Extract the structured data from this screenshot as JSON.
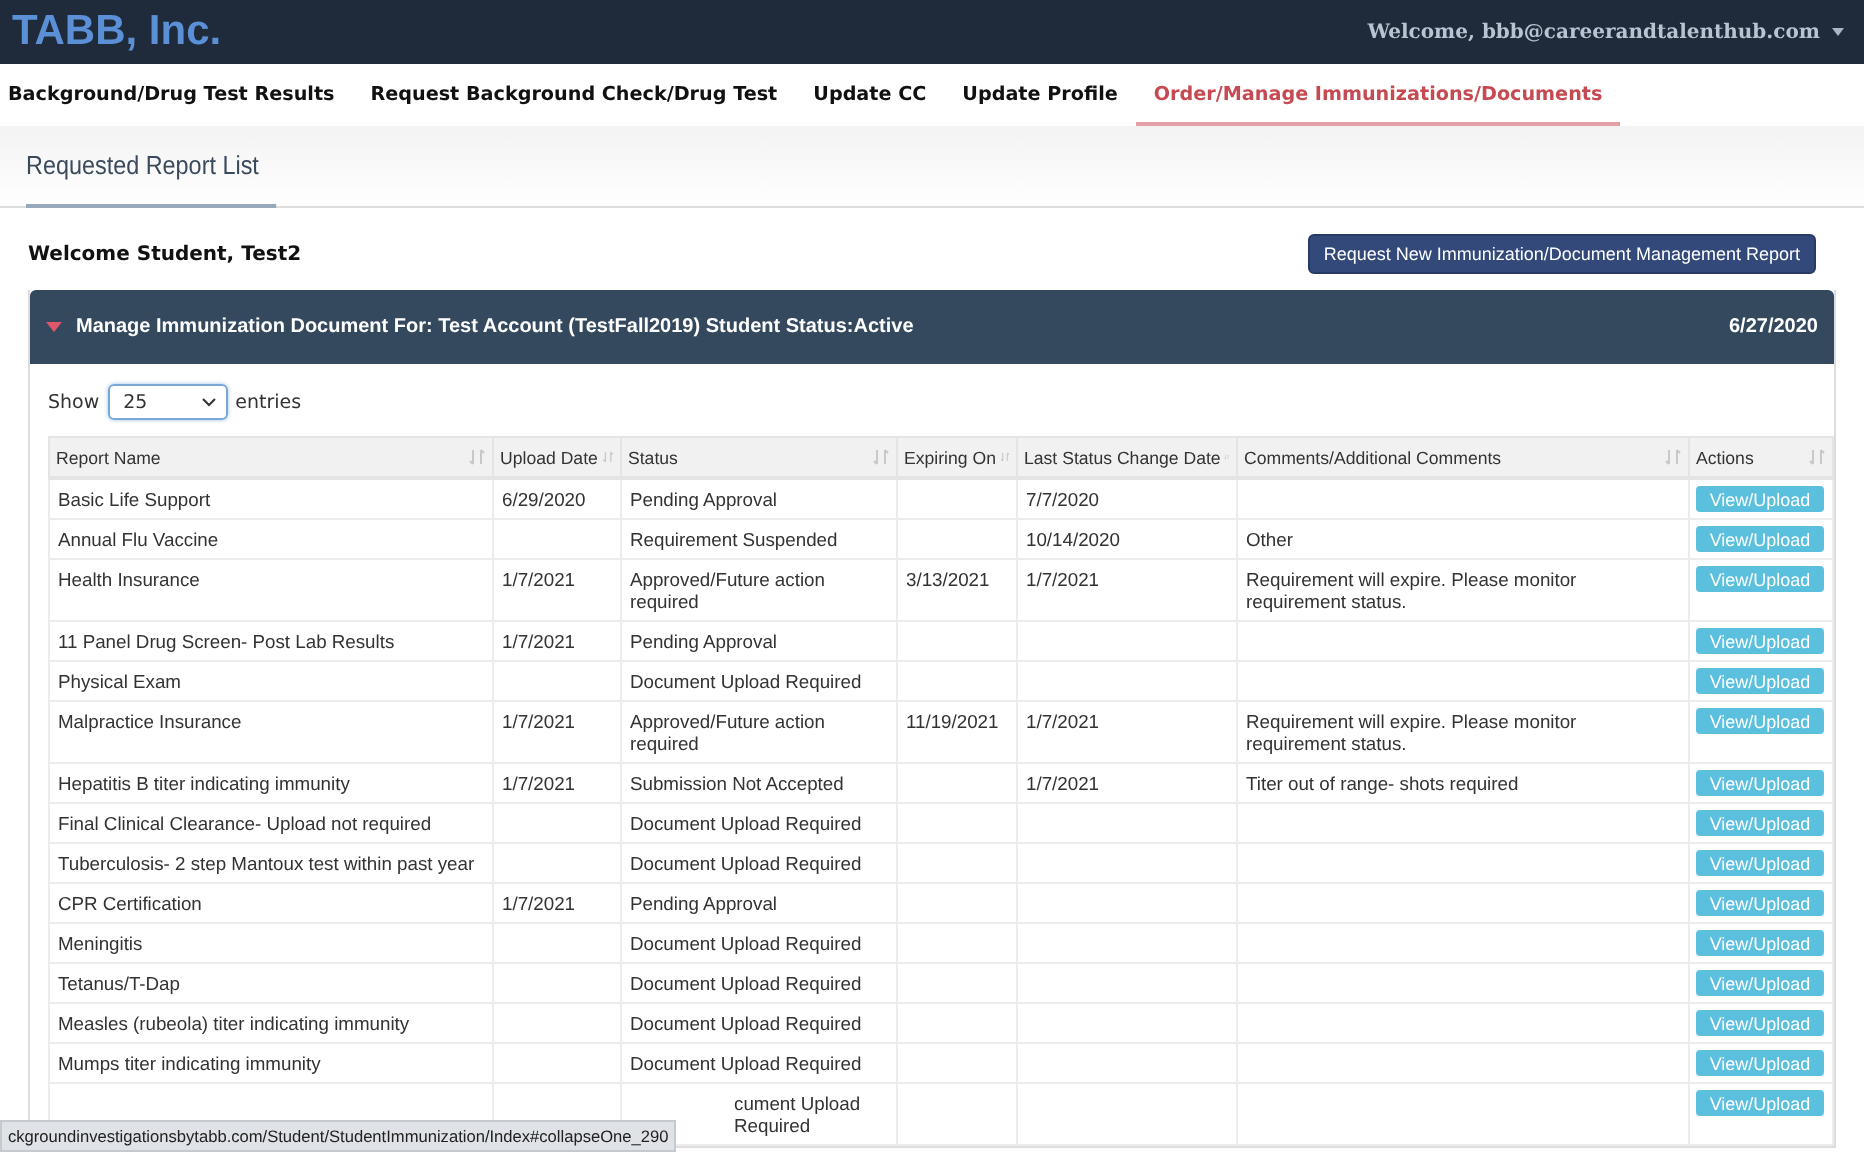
{
  "header": {
    "logo": "TABB, Inc.",
    "user": "Welcome, bbb@careerandtalenthub.com"
  },
  "nav": [
    {
      "label": "Background/Drug Test Results",
      "selected": false
    },
    {
      "label": "Request Background Check/Drug Test",
      "selected": false
    },
    {
      "label": "Update CC",
      "selected": false
    },
    {
      "label": "Update Profile",
      "selected": false
    },
    {
      "label": "Order/Manage Immunizations/Documents",
      "selected": true
    }
  ],
  "section_title": "Requested Report List",
  "welcome": "Welcome Student, Test2",
  "request_button": "Request New Immunization/Document Management Report",
  "panel": {
    "title": "Manage Immunization Document For: Test Account (TestFall2019) Student Status:Active",
    "date": "6/27/2020",
    "expanded": true
  },
  "entries": {
    "show": "Show",
    "value": "25",
    "suffix": "entries"
  },
  "table": {
    "columns": [
      "Report Name",
      "Upload Date",
      "Status",
      "Expiring On",
      "Last Status Change Date",
      "Comments/Additional Comments",
      "Actions"
    ],
    "rows": [
      {
        "name": "Basic Life Support",
        "upload_date": "6/29/2020",
        "status": "Pending Approval",
        "expiring_on": "",
        "last_change": "7/7/2020",
        "comments": "",
        "action": "View/Upload"
      },
      {
        "name": "Annual Flu Vaccine",
        "upload_date": "",
        "status": "Requirement Suspended",
        "expiring_on": "",
        "last_change": "10/14/2020",
        "comments": "Other",
        "action": "View/Upload"
      },
      {
        "name": "Health Insurance",
        "upload_date": "1/7/2021",
        "status": "Approved/Future action required",
        "expiring_on": "3/13/2021",
        "last_change": "1/7/2021",
        "comments": "Requirement will expire. Please monitor requirement status.",
        "action": "View/Upload"
      },
      {
        "name": "11 Panel Drug Screen- Post Lab Results",
        "upload_date": "1/7/2021",
        "status": "Pending Approval",
        "expiring_on": "",
        "last_change": "",
        "comments": "",
        "action": "View/Upload"
      },
      {
        "name": "Physical Exam",
        "upload_date": "",
        "status": "Document Upload Required",
        "expiring_on": "",
        "last_change": "",
        "comments": "",
        "action": "View/Upload"
      },
      {
        "name": "Malpractice Insurance",
        "upload_date": "1/7/2021",
        "status": "Approved/Future action required",
        "expiring_on": "11/19/2021",
        "last_change": "1/7/2021",
        "comments": "Requirement will expire. Please monitor requirement status.",
        "action": "View/Upload"
      },
      {
        "name": "Hepatitis B titer indicating immunity",
        "upload_date": "1/7/2021",
        "status": "Submission Not Accepted",
        "expiring_on": "",
        "last_change": "1/7/2021",
        "comments": "Titer out of range- shots required",
        "action": "View/Upload"
      },
      {
        "name": "Final Clinical Clearance- Upload not required",
        "upload_date": "",
        "status": "Document Upload Required",
        "expiring_on": "",
        "last_change": "",
        "comments": "",
        "action": "View/Upload"
      },
      {
        "name": "Tuberculosis- 2 step Mantoux test within past year",
        "upload_date": "",
        "status": "Document Upload Required",
        "expiring_on": "",
        "last_change": "",
        "comments": "",
        "action": "View/Upload"
      },
      {
        "name": "CPR Certification",
        "upload_date": "1/7/2021",
        "status": "Pending Approval",
        "expiring_on": "",
        "last_change": "",
        "comments": "",
        "action": "View/Upload"
      },
      {
        "name": "Meningitis",
        "upload_date": "",
        "status": "Document Upload Required",
        "expiring_on": "",
        "last_change": "",
        "comments": "",
        "action": "View/Upload"
      },
      {
        "name": "Tetanus/T-Dap",
        "upload_date": "",
        "status": "Document Upload Required",
        "expiring_on": "",
        "last_change": "",
        "comments": "",
        "action": "View/Upload"
      },
      {
        "name": "Measles (rubeola) titer indicating immunity",
        "upload_date": "",
        "status": "Document Upload Required",
        "expiring_on": "",
        "last_change": "",
        "comments": "",
        "action": "View/Upload"
      },
      {
        "name": "Mumps titer indicating immunity",
        "upload_date": "",
        "status": "Document Upload Required",
        "expiring_on": "",
        "last_change": "",
        "comments": "",
        "action": "View/Upload"
      },
      {
        "name": "",
        "upload_date": "",
        "status": "cument Upload Required",
        "expiring_on": "",
        "last_change": "",
        "comments": "",
        "action": "View/Upload"
      }
    ]
  },
  "status_bar": "ckgroundinvestigationsbytabb.com/Student/StudentImmunization/Index#collapseOne_290"
}
